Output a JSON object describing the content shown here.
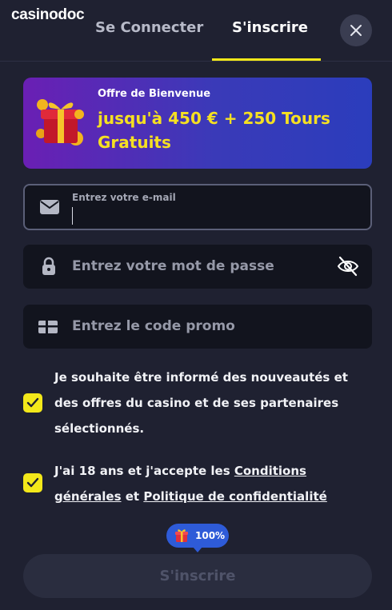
{
  "header": {
    "logo_text": "casinodoc",
    "tabs": [
      {
        "label": "Se Connecter",
        "active": false
      },
      {
        "label": "S'inscrire",
        "active": true
      }
    ],
    "close_icon": "close-icon"
  },
  "promo": {
    "subtitle": "Offre de Bienvenue",
    "title": "jusqu'à 450 € + 250 Tours Gratuits",
    "icon": "gift-icon"
  },
  "form": {
    "email": {
      "label": "Entrez votre e-mail",
      "value": "",
      "icon": "mail-icon"
    },
    "password": {
      "placeholder": "Entrez votre mot de passe",
      "icon": "lock-icon",
      "toggle_icon": "eye-off-icon"
    },
    "promo_code": {
      "placeholder": "Entrez le code promo",
      "icon": "gift-card-icon"
    }
  },
  "consents": {
    "newsletter": {
      "text": "Je souhaite être informé des nouveautés et des offres du casino et de ses partenaires sélectionnés.",
      "checked": true
    },
    "terms": {
      "prefix": "J'ai 18 ans et j'accepte les ",
      "link1": "Conditions générales",
      "middle": " et ",
      "link2": "Politique de confidentialité",
      "checked": true
    }
  },
  "progress": {
    "value": "100%",
    "icon": "gift-icon"
  },
  "submit": {
    "label": "S'inscrire"
  },
  "colors": {
    "accent": "#f3e81a",
    "background": "#1f2131",
    "field": "#12141e",
    "badge": "#2e5bd8"
  }
}
